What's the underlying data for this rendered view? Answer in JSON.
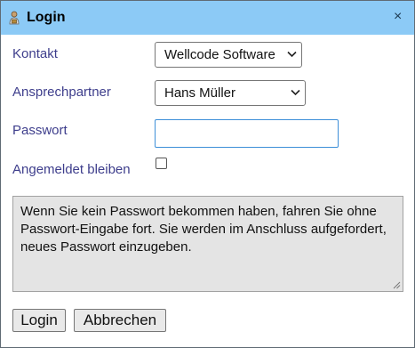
{
  "dialog": {
    "title": "Login",
    "icon": "user-lock-icon",
    "close_glyph": "×"
  },
  "form": {
    "contact_label": "Kontakt",
    "contact_value": "Wellcode Software",
    "person_label": "Ansprechpartner",
    "person_value": "Hans Müller",
    "password_label": "Passwort",
    "password_value": "",
    "remember_label": "Angemeldet bleiben",
    "remember_checked": false
  },
  "notice": {
    "text": "Wenn Sie kein Passwort bekommen haben, fahren Sie ohne Passwort-Eingabe fort. Sie werden im Anschluss aufgefordert, neues Passwort einzugeben."
  },
  "buttons": {
    "login": "Login",
    "cancel": "Abbrechen"
  },
  "colors": {
    "titlebar": "#8ccaf6",
    "label": "#3e3e8c",
    "focus_border": "#3d8fd8"
  }
}
